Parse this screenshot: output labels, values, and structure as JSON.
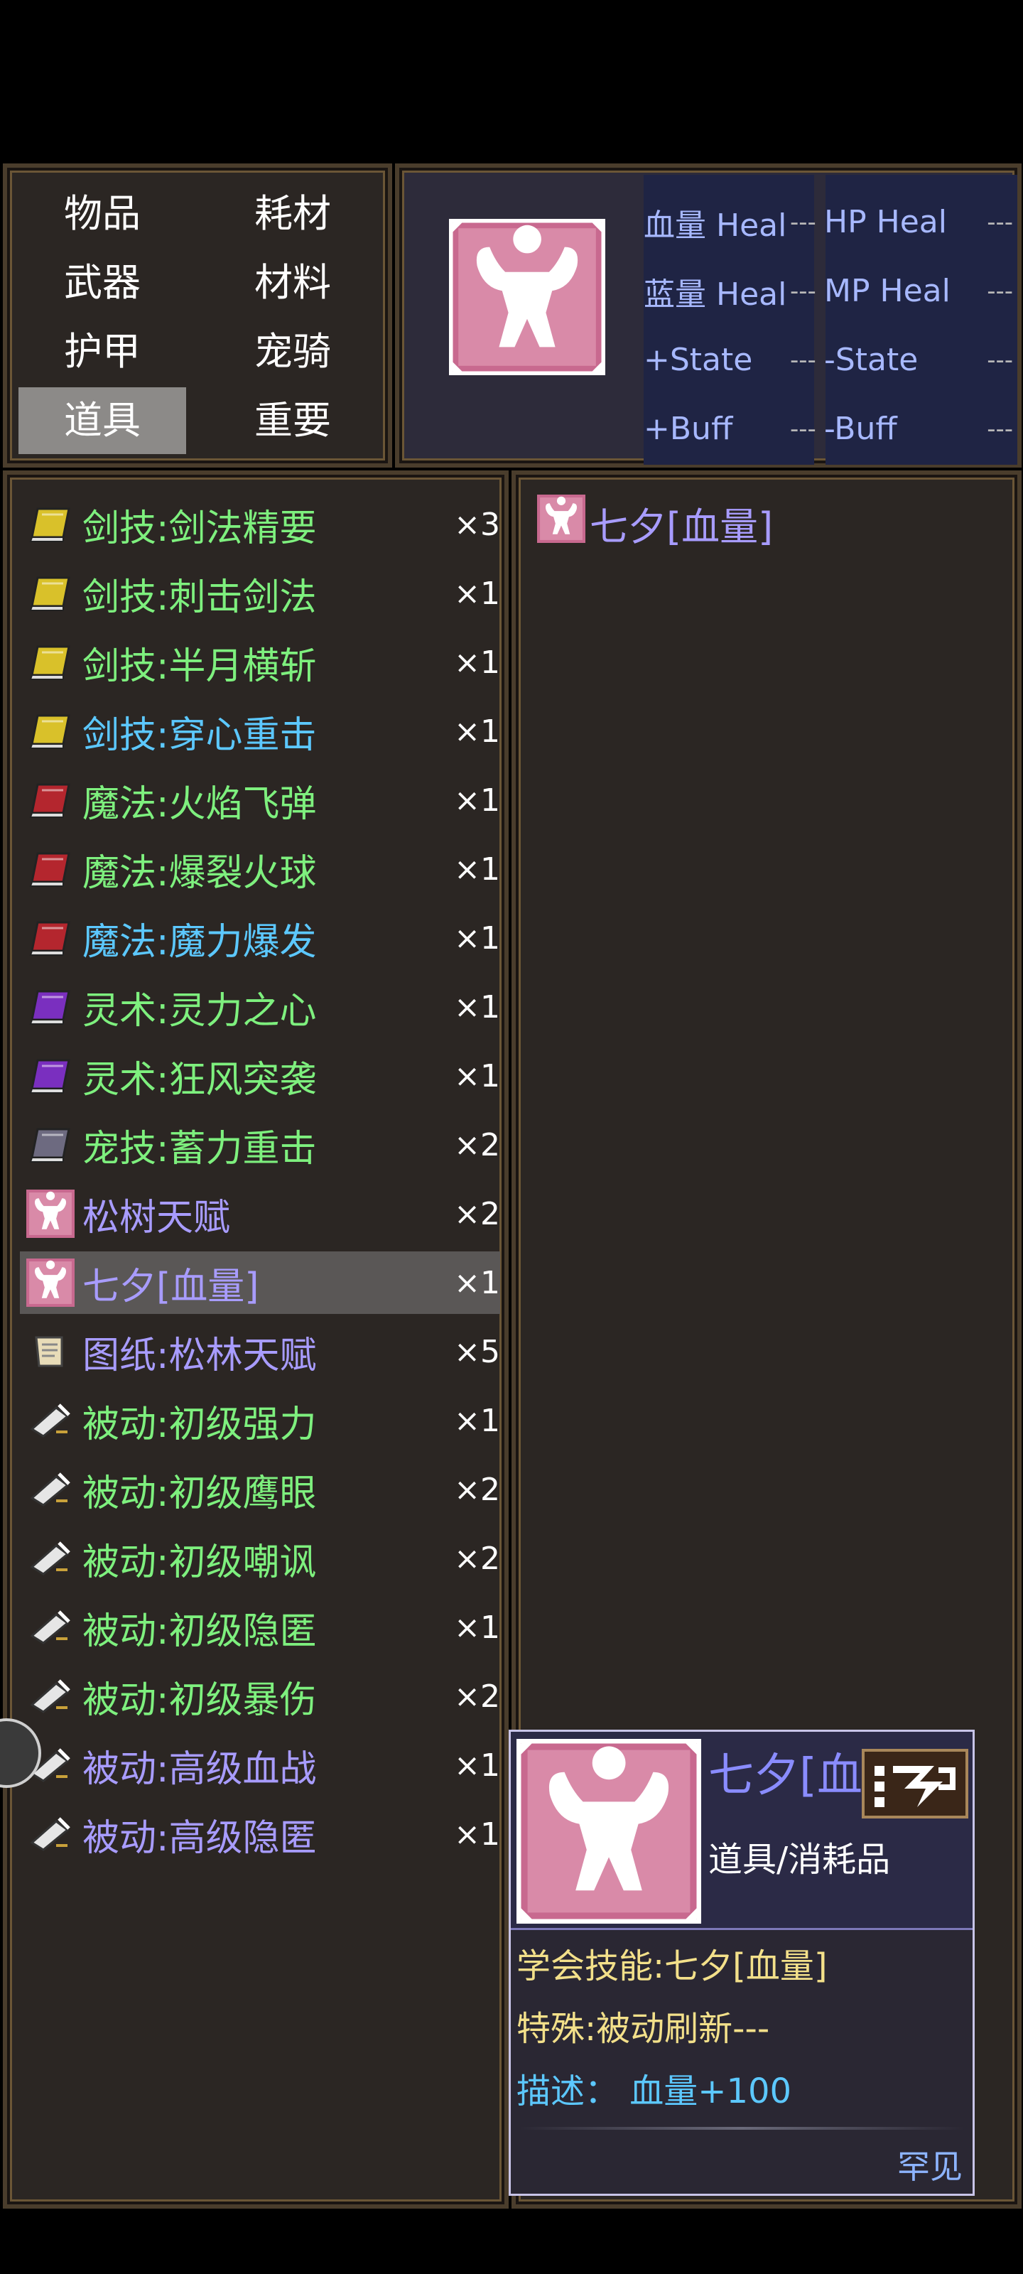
{
  "categories": [
    {
      "label": "物品"
    },
    {
      "label": "耗材"
    },
    {
      "label": "武器"
    },
    {
      "label": "材料"
    },
    {
      "label": "护甲"
    },
    {
      "label": "宠骑"
    },
    {
      "label": "道具",
      "active": true
    },
    {
      "label": "重要"
    }
  ],
  "stats": [
    {
      "label": "血量 Heal",
      "value": "---",
      "label2": "HP Heal",
      "value2": "---"
    },
    {
      "label": "蓝量 Heal",
      "value": "---",
      "label2": "MP Heal",
      "value2": "---"
    },
    {
      "label": "+State",
      "value": "---",
      "label2": "-State",
      "value2": "---"
    },
    {
      "label": "+Buff",
      "value": "---",
      "label2": "-Buff",
      "value2": "---"
    }
  ],
  "items": [
    {
      "name": "剑技:剑法精要",
      "count": "×3",
      "icon": "yellow-book-icon",
      "color": "green"
    },
    {
      "name": "剑技:刺击剑法",
      "count": "×1",
      "icon": "yellow-book-icon",
      "color": "green"
    },
    {
      "name": "剑技:半月横斩",
      "count": "×1",
      "icon": "yellow-book-icon",
      "color": "green"
    },
    {
      "name": "剑技:穿心重击",
      "count": "×1",
      "icon": "yellow-book-icon",
      "color": "blue"
    },
    {
      "name": "魔法:火焰飞弹",
      "count": "×1",
      "icon": "red-book-icon",
      "color": "green"
    },
    {
      "name": "魔法:爆裂火球",
      "count": "×1",
      "icon": "red-book-icon",
      "color": "green"
    },
    {
      "name": "魔法:魔力爆发",
      "count": "×1",
      "icon": "red-book-icon",
      "color": "blue"
    },
    {
      "name": "灵术:灵力之心",
      "count": "×1",
      "icon": "purple-book-icon",
      "color": "green"
    },
    {
      "name": "灵术:狂风突袭",
      "count": "×1",
      "icon": "purple-book-icon",
      "color": "green"
    },
    {
      "name": "宠技:蓄力重击",
      "count": "×2",
      "icon": "grey-book-icon",
      "color": "green"
    },
    {
      "name": "松树天赋",
      "count": "×2",
      "icon": "strength-icon",
      "color": "purple"
    },
    {
      "name": "七夕[血量]",
      "count": "×1",
      "icon": "strength-icon",
      "color": "purple",
      "selected": true
    },
    {
      "name": "图纸:松林天赋",
      "count": "×5",
      "icon": "scroll-icon",
      "color": "purple"
    },
    {
      "name": "被动:初级强力",
      "count": "×1",
      "icon": "quill-scroll-icon",
      "color": "green"
    },
    {
      "name": "被动:初级鹰眼",
      "count": "×2",
      "icon": "quill-scroll-icon",
      "color": "green"
    },
    {
      "name": "被动:初级嘲讽",
      "count": "×2",
      "icon": "quill-scroll-icon",
      "color": "green"
    },
    {
      "name": "被动:初级隐匿",
      "count": "×1",
      "icon": "quill-scroll-icon",
      "color": "green"
    },
    {
      "name": "被动:初级暴伤",
      "count": "×2",
      "icon": "quill-scroll-icon",
      "color": "green"
    },
    {
      "name": "被动:高级血战",
      "count": "×1",
      "icon": "quill-scroll-icon",
      "color": "purple"
    },
    {
      "name": "被动:高级隐匿",
      "count": "×1",
      "icon": "quill-scroll-icon",
      "color": "purple"
    }
  ],
  "detail": {
    "title": "七夕[血量]"
  },
  "card": {
    "title": "七夕[血量]",
    "type": "道具/消耗品",
    "learn": "学会技能:七夕[血量]",
    "special": "特殊:被动刷新---",
    "desc": "描述：  血量+100",
    "rarity": "罕见"
  },
  "colors": {
    "green": "#7ef07e",
    "blue": "#5cc8ff",
    "purple": "#a89cff",
    "gold_text": "#f3e08a",
    "item_pink": "#c8698f"
  }
}
